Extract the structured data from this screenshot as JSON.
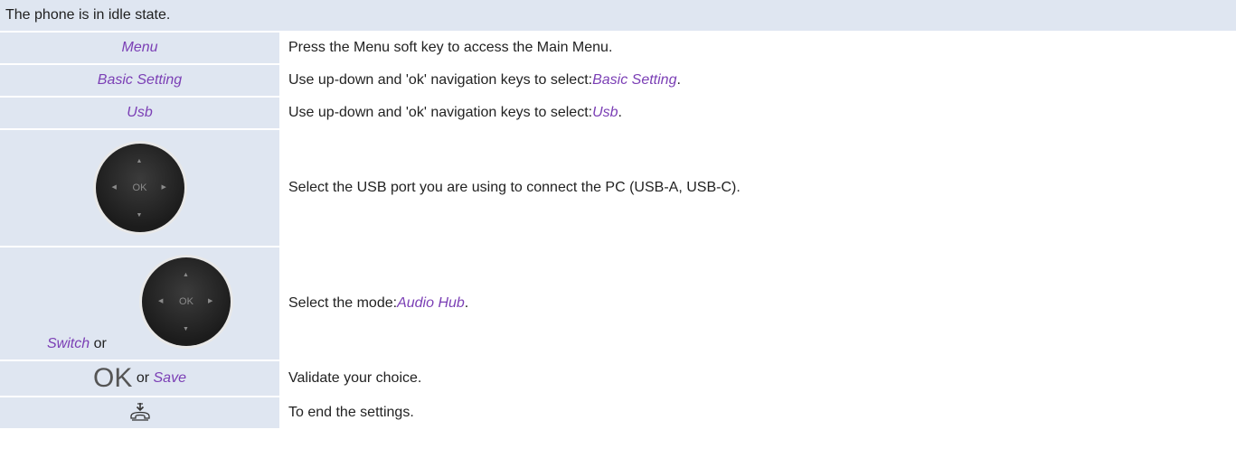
{
  "header": {
    "text": "The phone is in idle state."
  },
  "rows": [
    {
      "left": "Menu",
      "right": "Press the Menu soft key to access the Main Menu."
    },
    {
      "left": "Basic Setting",
      "right_prefix": "Use up-down and 'ok' navigation keys to select: ",
      "right_em": "Basic Setting",
      "right_suffix": "."
    },
    {
      "left": "Usb",
      "right_prefix": "Use up-down and 'ok' navigation keys to select: ",
      "right_em": "Usb",
      "right_suffix": "."
    },
    {
      "left_ok": "OK",
      "right": "Select the USB port you are using to connect the PC (USB-A, USB-C)."
    },
    {
      "left_switch": "Switch",
      "left_or": " or",
      "left_ok": "OK",
      "right_prefix": "Select the mode: ",
      "right_em": "Audio Hub",
      "right_suffix": "."
    },
    {
      "left_ok_big": "OK",
      "left_or": " or ",
      "left_save": "Save",
      "right": "Validate your choice."
    },
    {
      "right": "To end the settings."
    }
  ],
  "icons": {
    "navigator": "navigator-icon",
    "hangup": "hang-up-icon"
  },
  "colors": {
    "header_bg": "#dfe6f1",
    "left_bg": "#dfe6f1",
    "softkey": "#7b3fb5"
  }
}
